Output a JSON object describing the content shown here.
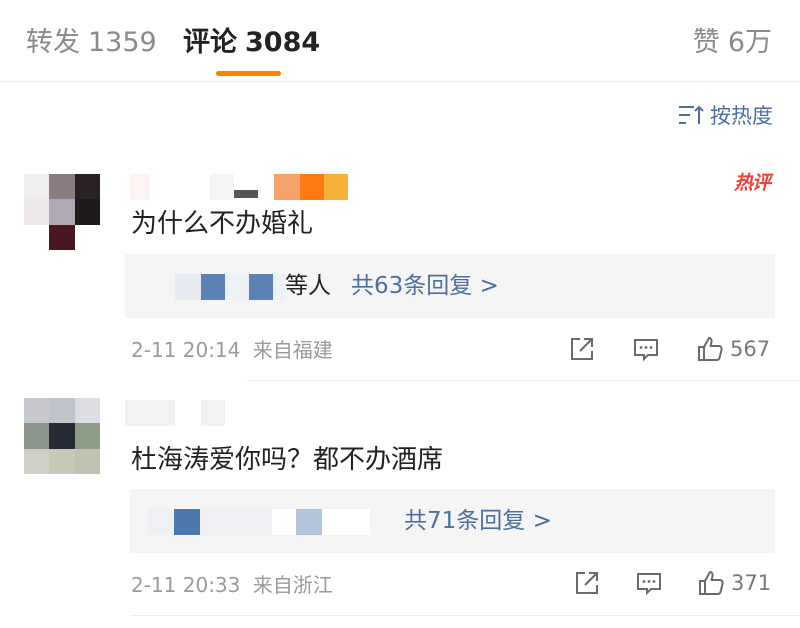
{
  "tabs": {
    "repost": {
      "label": "转发",
      "count": "1359"
    },
    "comments": {
      "label": "评论",
      "count": "3084"
    },
    "likes": {
      "label": "赞",
      "count": "6万"
    }
  },
  "sort": {
    "label": "按热度",
    "icon": "sort-icon"
  },
  "comments": [
    {
      "hot_badge": "热评",
      "text": "为什么不办婚礼",
      "reply_suffix": "等人",
      "reply_link": "共63条回复 >",
      "time": "2-11 20:14",
      "location": "来自福建",
      "likes": "567"
    },
    {
      "text": "杜海涛爱你吗？都不办酒席",
      "reply_link": "共71条回复 >",
      "time": "2-11 20:33",
      "location": "来自浙江",
      "likes": "371"
    }
  ],
  "colors": {
    "accent": "#ff8200",
    "link": "#4e6f9c",
    "hot": "#e8453c",
    "muted": "#9a9a9a"
  }
}
